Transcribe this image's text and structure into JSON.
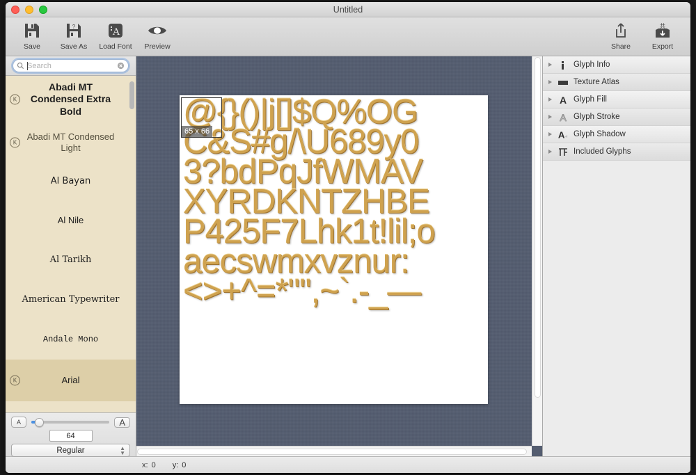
{
  "window": {
    "title": "Untitled"
  },
  "toolbar": {
    "left": [
      {
        "label": "Save",
        "icon": "floppy-disk-icon"
      },
      {
        "label": "Save As",
        "icon": "floppy-disk-question-icon"
      },
      {
        "label": "Load Font",
        "icon": "load-font-icon"
      },
      {
        "label": "Preview",
        "icon": "eye-icon"
      }
    ],
    "right": [
      {
        "label": "Share",
        "icon": "share-icon"
      },
      {
        "label": "Export",
        "icon": "export-icon"
      }
    ]
  },
  "search": {
    "placeholder": "Search",
    "value": ""
  },
  "fonts": [
    {
      "name": "Abadi MT Condensed Extra Bold",
      "badge": "K",
      "selected": false
    },
    {
      "name": "Abadi MT Condensed Light",
      "badge": "K",
      "selected": false
    },
    {
      "name": "Al Bayan",
      "badge": "",
      "selected": false
    },
    {
      "name": "Al Nile",
      "badge": "",
      "selected": false
    },
    {
      "name": "Al Tarikh",
      "badge": "",
      "selected": false
    },
    {
      "name": "American Typewriter",
      "badge": "",
      "selected": false
    },
    {
      "name": "Andale Mono",
      "badge": "",
      "selected": false
    },
    {
      "name": "Arial",
      "badge": "K",
      "selected": true
    }
  ],
  "size_controls": {
    "small_label": "A",
    "large_label": "A",
    "value": "64",
    "slider_percent": 8
  },
  "style_select": {
    "value": "Regular"
  },
  "canvas": {
    "selection": {
      "size_label": "65 x 66"
    },
    "glyph_rows": [
      "@{}()|j[]$Q%OG",
      "C&S#g/\\U689y0",
      "3?bdPqJfWMAV",
      "XYRDKNTZHBE",
      "P425F7Lhk1t!lil;o",
      "aecswmxvznur:",
      "<>+^=*\"'',~`.-_—"
    ]
  },
  "inspector": [
    {
      "label": "Glyph Info",
      "icon": "info-icon"
    },
    {
      "label": "Texture Atlas",
      "icon": "texture-atlas-icon"
    },
    {
      "label": "Glyph Fill",
      "icon": "glyph-fill-icon"
    },
    {
      "label": "Glyph Stroke",
      "icon": "glyph-stroke-icon"
    },
    {
      "label": "Glyph Shadow",
      "icon": "glyph-shadow-icon"
    },
    {
      "label": "Included Glyphs",
      "icon": "included-glyphs-icon"
    }
  ],
  "statusbar": {
    "x_label": "x:",
    "x_value": "0",
    "y_label": "y:",
    "y_value": "0"
  },
  "colors": {
    "glyph_fill": "#cfa24f",
    "canvas_bg": "#545d70",
    "sidebar_bg": "#ece2c8",
    "selection_bg": "#ddcfa8",
    "accent": "#4a90e2"
  }
}
